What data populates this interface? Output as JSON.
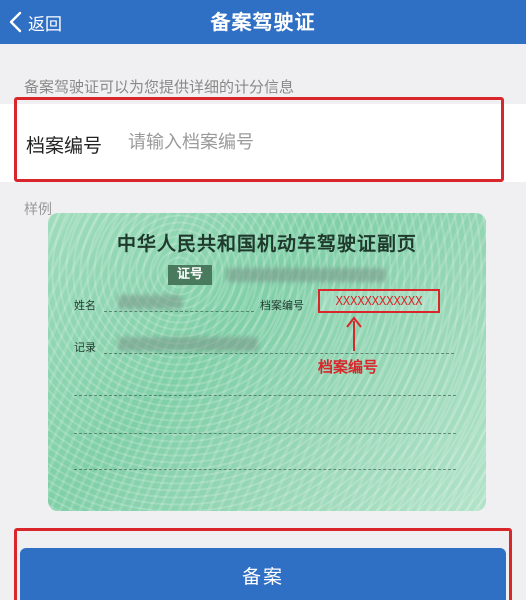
{
  "header": {
    "back_label": "返回",
    "title": "备案驾驶证"
  },
  "hint": "备案驾驶证可以为您提供详细的计分信息",
  "form": {
    "field_label": "档案编号",
    "field_placeholder": "请输入档案编号",
    "field_value": ""
  },
  "sample": {
    "label": "样例",
    "card_title": "中华人民共和国机动车驾驶证副页",
    "cert_badge": "证号",
    "name_label": "姓名",
    "file_no_label": "档案编号",
    "file_no_value": "XXXXXXXXXXXX",
    "record_label": "记录",
    "annotation": "档案编号"
  },
  "submit": {
    "label": "备案"
  },
  "colors": {
    "brand": "#2f6fc4",
    "highlight": "#d9262b",
    "card_green": "#8fd6b0"
  },
  "icons": {
    "back": "chevron-left-icon",
    "arrow": "up-arrow-icon"
  }
}
